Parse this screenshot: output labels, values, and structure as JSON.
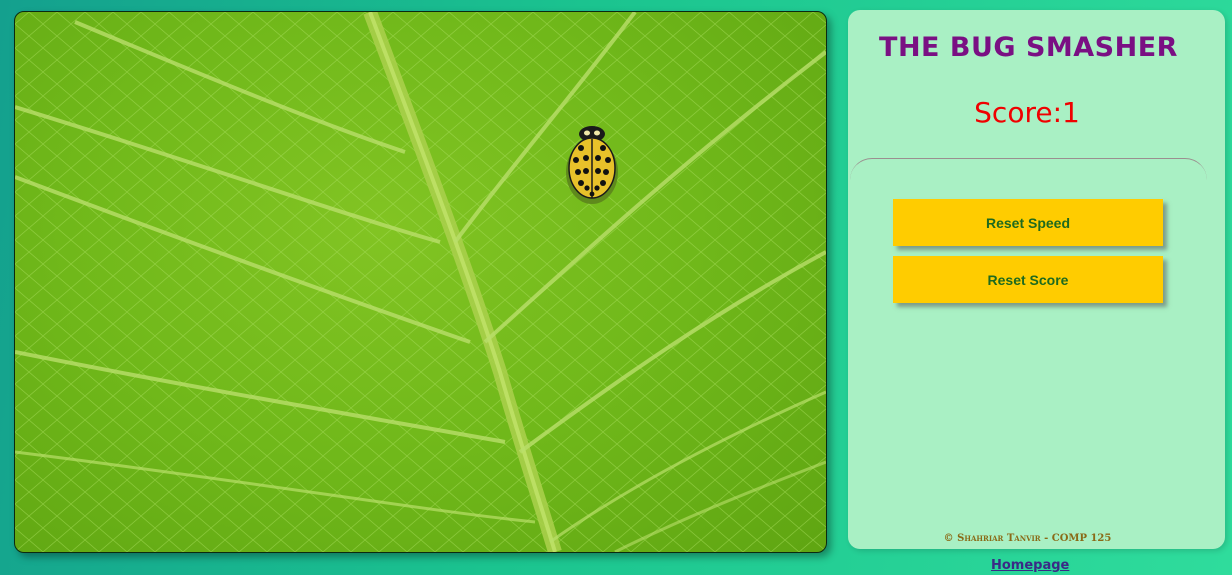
{
  "game": {
    "title": "THE BUG SMASHER",
    "score_text": "Score:1",
    "buttons": {
      "reset_speed": "Reset Speed",
      "reset_score": "Reset Score"
    },
    "footer": "© Shahriar Tanvir - COMP 125"
  },
  "nav": {
    "homepage_link": "Homepage"
  },
  "colors": {
    "title": "#7a0f83",
    "score": "#f00000",
    "button_bg": "#ffcc00",
    "button_text": "#1e6a1e",
    "panel_bg": "#a9f0c4"
  },
  "icons": {
    "bug": "ladybug-icon"
  }
}
